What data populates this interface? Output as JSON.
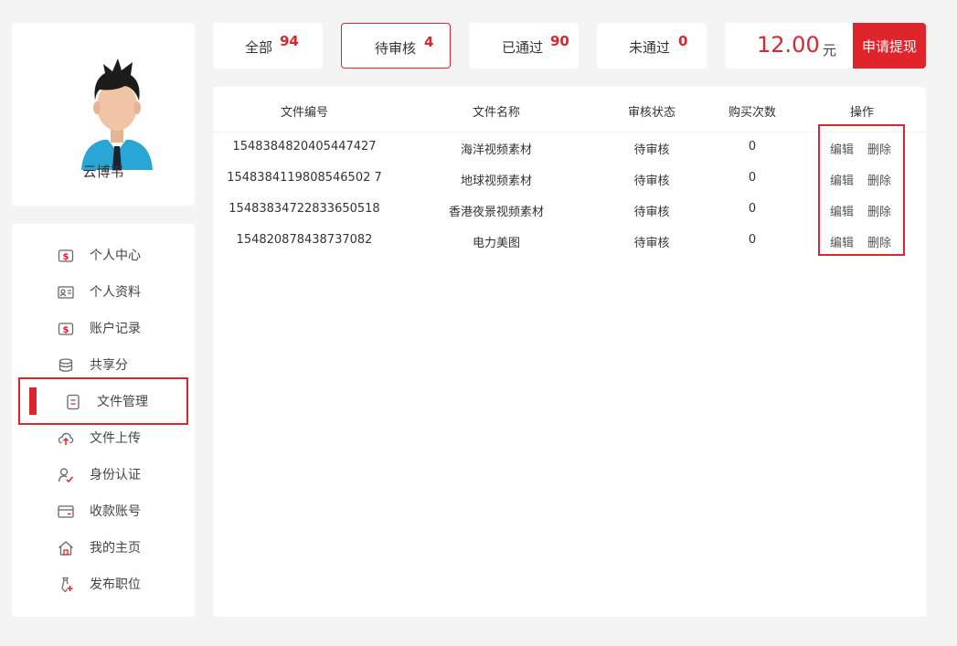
{
  "profile": {
    "username": "云博韦"
  },
  "menu": {
    "items": [
      {
        "label": "个人中心",
        "icon": "dollar-card-icon"
      },
      {
        "label": "个人资料",
        "icon": "id-card-icon"
      },
      {
        "label": "账户记录",
        "icon": "dollar-card-icon"
      },
      {
        "label": "共享分",
        "icon": "coins-stack-icon"
      },
      {
        "label": "文件管理",
        "icon": "document-icon",
        "active": true
      },
      {
        "label": "文件上传",
        "icon": "cloud-upload-icon"
      },
      {
        "label": "身份认证",
        "icon": "user-check-icon"
      },
      {
        "label": "收款账号",
        "icon": "credit-card-icon"
      },
      {
        "label": "我的主页",
        "icon": "home-icon"
      },
      {
        "label": "发布职位",
        "icon": "tie-add-icon"
      }
    ]
  },
  "tabs": [
    {
      "label": "全部",
      "count": "94"
    },
    {
      "label": "待审核",
      "count": "4",
      "active": true
    },
    {
      "label": "已通过",
      "count": "90"
    },
    {
      "label": "未通过",
      "count": "0"
    }
  ],
  "balance": {
    "amount": "12.00",
    "unit": "元",
    "withdraw_label": "申请提现"
  },
  "table": {
    "headers": [
      "文件编号",
      "文件名称",
      "审核状态",
      "购买次数",
      "操作"
    ],
    "rows": [
      {
        "id": "1548384820405447427",
        "name": "海洋视频素材",
        "status": "待审核",
        "purchases": "0",
        "edit": "编辑",
        "delete": "删除"
      },
      {
        "id": "1548384119808546502 7",
        "name": "地球视频素材",
        "status": "待审核",
        "purchases": "0",
        "edit": "编辑",
        "delete": "删除"
      },
      {
        "id": "15483834722833650518",
        "name": "香港夜景视频素材",
        "status": "待审核",
        "purchases": "0",
        "edit": "编辑",
        "delete": "删除"
      },
      {
        "id": "154820878438737082",
        "name": "电力美图",
        "status": "待审核",
        "purchases": "0",
        "edit": "编辑",
        "delete": "删除"
      }
    ]
  },
  "colors": {
    "accent": "#e0242c",
    "background": "#f4f4f4"
  }
}
